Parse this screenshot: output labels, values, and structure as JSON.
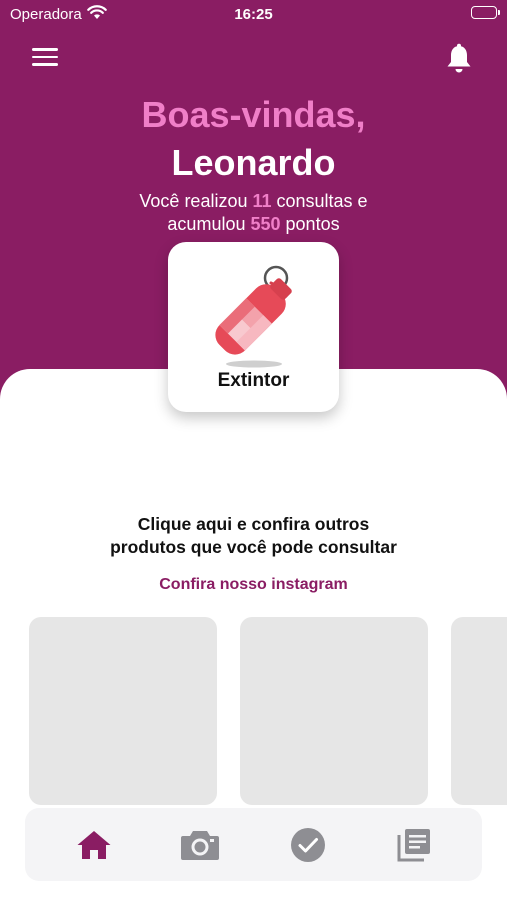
{
  "status_bar": {
    "carrier": "Operadora",
    "time": "16:25"
  },
  "header": {
    "greeting": "Boas-vindas,",
    "user_name": "Leonardo",
    "summary_line1_pre": "Você realizou ",
    "consultas": "11",
    "summary_line1_post": " consultas e",
    "summary_line2_pre": "acumulou ",
    "pontos": "550",
    "summary_line2_post": " pontos"
  },
  "product_card": {
    "label": "Extintor",
    "icon": "fire-extinguisher-icon"
  },
  "cta": {
    "line1": "Clique aqui e confira outros",
    "line2": "produtos que você pode consultar"
  },
  "instagram_link": "Confira nosso instagram",
  "tab_bar": {
    "tabs": [
      {
        "name": "home",
        "icon": "home-icon",
        "active": true
      },
      {
        "name": "camera",
        "icon": "camera-icon",
        "active": false
      },
      {
        "name": "check",
        "icon": "check-circle-icon",
        "active": false
      },
      {
        "name": "documents",
        "icon": "documents-icon",
        "active": false
      }
    ]
  },
  "colors": {
    "brand": "#8a1d63",
    "accent": "#f07fc8",
    "tab_active": "#8a1d63",
    "tab_inactive": "#8e8e93",
    "placeholder": "#e6e6e6"
  }
}
